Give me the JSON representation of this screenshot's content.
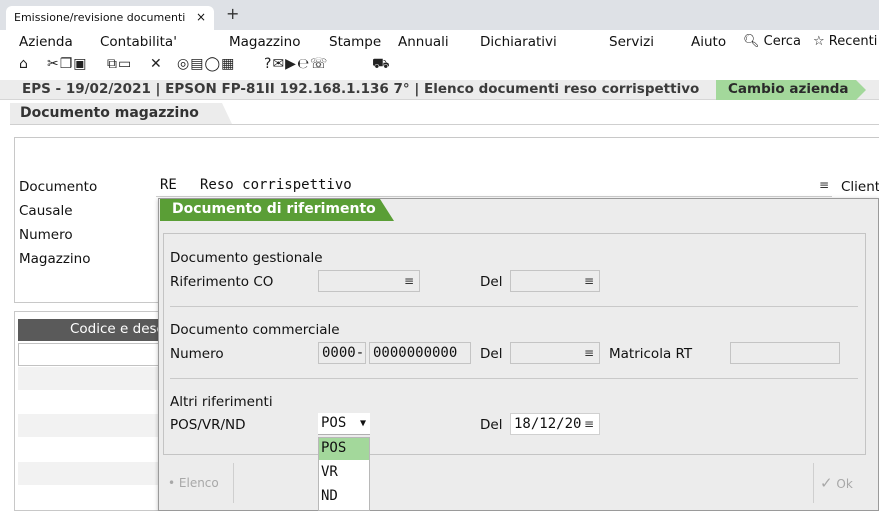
{
  "browser": {
    "tab_title": "Emissione/revisione documenti",
    "tab_close": "×",
    "new_tab": "+"
  },
  "menu": {
    "items": [
      "Azienda",
      "Contabilita'",
      "Magazzino",
      "Stampe",
      "Annuali",
      "Dichiarativi",
      "Servizi",
      "Aiuto"
    ],
    "search": "Cerca",
    "recent": "Recenti"
  },
  "toolbar": {
    "icons": [
      "home-icon",
      "cut-icon",
      "copy-icon",
      "paste-icon",
      "network-icon",
      "monitor-icon",
      "close-x-icon",
      "camera-icon",
      "disk-icon",
      "agent-icon",
      "calculator-icon",
      "help-icon",
      "contact-icon",
      "video-icon",
      "epayment-icon",
      "chat-icon",
      "cart-icon"
    ]
  },
  "status": {
    "text": "EPS - 19/02/2021 | EPSON FP-81II 192.168.1.136 7° | Elenco documenti reso corrispettivo",
    "company_button": "Cambio azienda"
  },
  "window": {
    "title": "Documento magazzino"
  },
  "main": {
    "documento_label": "Documento",
    "documento_code": "RE",
    "documento_desc": "Reso corrispettivo",
    "cliente_label": "Client",
    "causale_label": "Causale",
    "numero_label": "Numero",
    "magazzino_label": "Magazzino",
    "trailing_e": "e",
    "grid_header": "Codice e desc"
  },
  "dialog": {
    "title": "Documento di riferimento",
    "gestionale": {
      "heading": "Documento gestionale",
      "rif_label": "Riferimento CO",
      "del_label": "Del"
    },
    "commerciale": {
      "heading": "Documento commerciale",
      "numero_label": "Numero",
      "numero_prefix": "0000-",
      "numero_value": "0000000000",
      "del_label": "Del",
      "matricola_label": "Matricola RT"
    },
    "altri": {
      "heading": "Altri riferimenti",
      "pos_label": "POS/VR/ND",
      "pos_selected": "POS",
      "options": [
        "POS",
        "VR",
        "ND"
      ],
      "del_label": "Del",
      "del_value": "18/12/20"
    },
    "elenco_button": "Elenco",
    "ok_button": "Ok"
  }
}
